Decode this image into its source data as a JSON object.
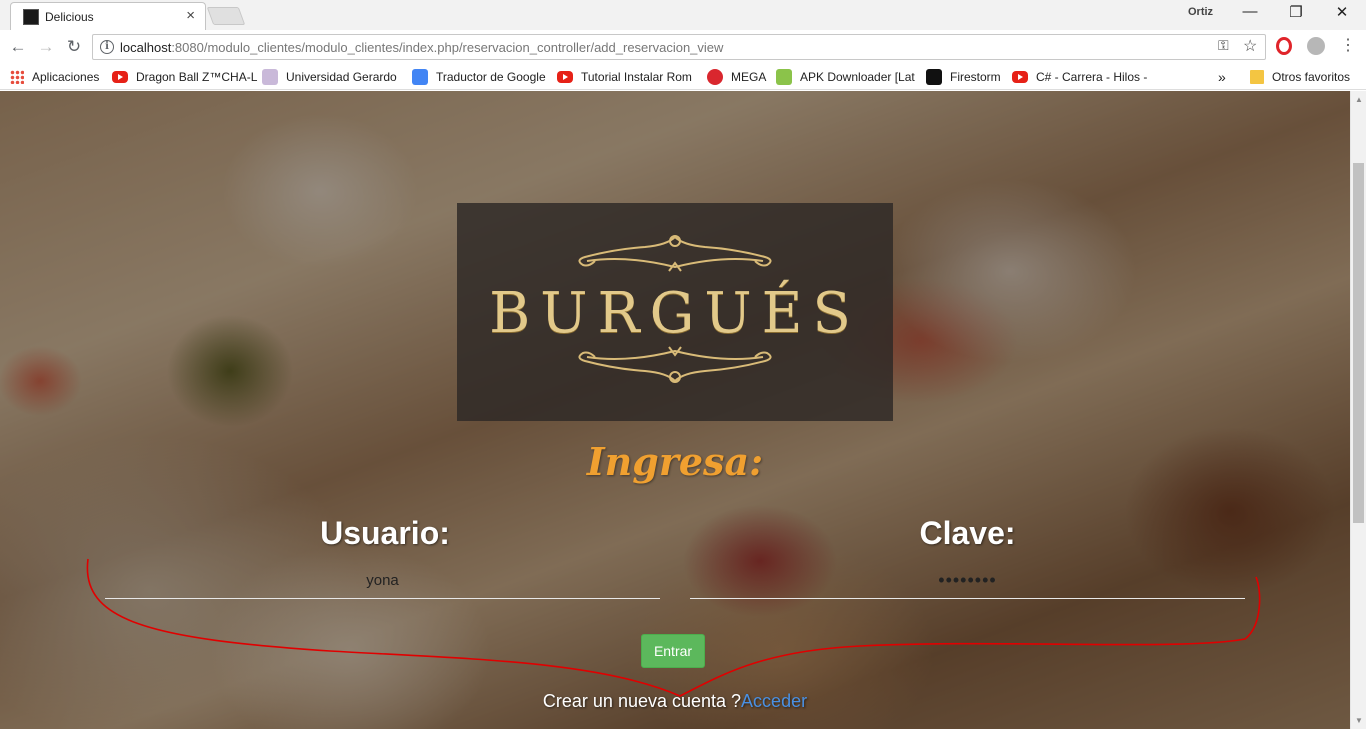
{
  "browser": {
    "tab_title": "Delicious",
    "tab_close": "×",
    "profile_name": "Ortiz",
    "window_controls": {
      "minimize": "—",
      "restore": "❐",
      "close": "✕"
    },
    "nav": {
      "back": "←",
      "forward": "→",
      "reload": "↻"
    },
    "url_host": "localhost",
    "url_rest": ":8080/modulo_clientes/modulo_clientes/index.php/reservacion_controller/add_reservacion_view",
    "url_icons": {
      "key": "⚿",
      "star": "☆"
    },
    "menu": "⋮"
  },
  "bookmarks": {
    "items": [
      {
        "label": "Aplicaciones",
        "icon": "apps-grid-icon"
      },
      {
        "label": "Dragon Ball Z™CHA-L",
        "icon": "youtube-icon"
      },
      {
        "label": "Universidad Gerardo",
        "icon": "university-icon"
      },
      {
        "label": "Traductor de Google",
        "icon": "google-translate-icon"
      },
      {
        "label": "Tutorial Instalar Rom",
        "icon": "youtube-icon"
      },
      {
        "label": "MEGA",
        "icon": "mega-icon"
      },
      {
        "label": "APK Downloader [Lat",
        "icon": "apk-icon"
      },
      {
        "label": "Firestorm",
        "icon": "firestorm-icon"
      },
      {
        "label": "C# - Carrera - Hilos -",
        "icon": "youtube-icon"
      }
    ],
    "overflow": "»",
    "other_favorites": "Otros favoritos"
  },
  "page": {
    "logo_text": "BURGUÉS",
    "heading": "Ingresa:",
    "username_label": "Usuario:",
    "username_value": "yona",
    "password_label": "Clave:",
    "password_value": "yonazain",
    "submit_label": "Entrar",
    "register_text": "Crear un nueva cuenta ?",
    "register_link": "Acceder"
  },
  "colors": {
    "logo_gold": "#e2c98a",
    "heading_orange": "#f0a030",
    "button_green": "#5cb85c",
    "link_blue": "#4a90e2",
    "annotation_red": "#e00000"
  }
}
